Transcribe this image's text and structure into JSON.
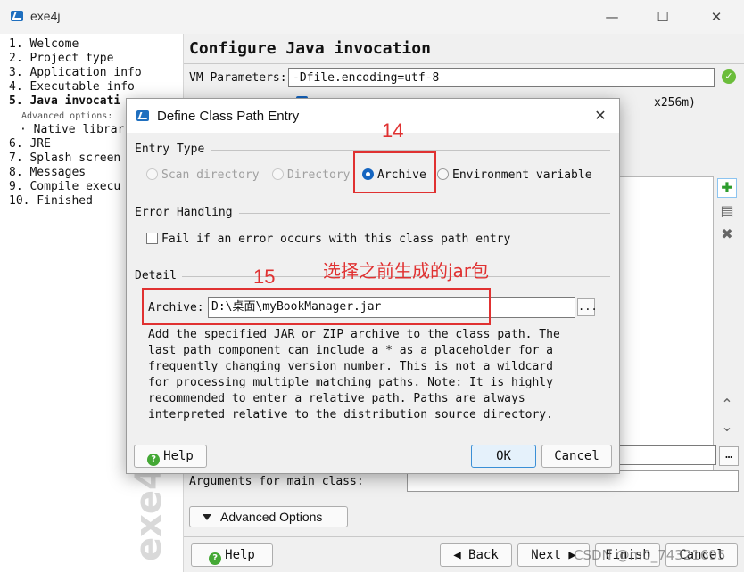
{
  "window": {
    "title": "exe4j",
    "minimize_icon": "minimize-icon",
    "maximize_icon": "maximize-icon",
    "close_icon": "close-icon"
  },
  "steps": [
    {
      "label": "1.  Welcome"
    },
    {
      "label": "2.  Project type"
    },
    {
      "label": "3.  Application info"
    },
    {
      "label": "4.  Executable info"
    },
    {
      "label": "5.  Java invocati"
    },
    {
      "label": "Advanced options:"
    },
    {
      "label": "· Native librar"
    },
    {
      "label": "6.  JRE"
    },
    {
      "label": "7.  Splash screen"
    },
    {
      "label": "8.  Messages"
    },
    {
      "label": "9.  Compile execu"
    },
    {
      "label": "10. Finished"
    }
  ],
  "main": {
    "page_title": "Configure Java invocation",
    "vm_parameters_label": "VM Parameters:",
    "vm_parameters_value": "-Dfile.encoding=utf-8",
    "memory_hint": "x256m)",
    "arguments_label": "Arguments for main class:",
    "advanced_options_label": "Advanced Options",
    "help_label": "Help",
    "back_label": "◀ Back",
    "next_label": "Next ▶",
    "finish_label": "Finish",
    "cancel_label": "Cancel",
    "watermark": "exe4j"
  },
  "dialog": {
    "title": "Define Class Path Entry",
    "entry_type_heading": "Entry Type",
    "entry_types": [
      {
        "label": "Scan directory",
        "state": "disabled"
      },
      {
        "label": "Directory",
        "state": "disabled"
      },
      {
        "label": "Archive",
        "state": "selected"
      },
      {
        "label": "Environment variable",
        "state": "enabled"
      }
    ],
    "error_handling_heading": "Error Handling",
    "fail_checkbox_label": "Fail if an error occurs with this class path entry",
    "detail_heading": "Detail",
    "archive_label": "Archive:",
    "archive_value": "D:\\桌面\\myBookManager.jar",
    "browse_label": "...",
    "description": "Add the specified JAR or ZIP archive to the class path. The\nlast path component can include a * as a placeholder for a\nfrequently changing version number. This is not a wildcard\nfor processing multiple matching paths. Note: It is highly\nrecommended to enter a relative path. Paths are always\ninterpreted relative to the distribution source directory.",
    "help_label": "Help",
    "ok_label": "OK",
    "cancel_label": "Cancel"
  },
  "annotations": {
    "step14": "14",
    "step15": "15",
    "note": "选择之前生成的jar包",
    "color": "#e03131"
  },
  "footer_watermark": "CSDN @m0_74321695"
}
